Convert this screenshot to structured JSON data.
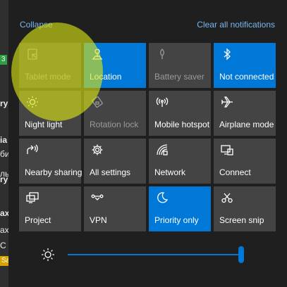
{
  "background_app": {
    "fragments": [
      "3",
      "ry",
      "ia",
      "би",
      "ль",
      "ry",
      "ax",
      "ах",
      "С",
      "Sa"
    ]
  },
  "header": {
    "collapse_label": "Collapse",
    "clear_label": "Clear all notifications"
  },
  "tiles": [
    {
      "label": "Tablet mode",
      "icon": "tablet-mode-icon",
      "state": "off"
    },
    {
      "label": "Location",
      "icon": "location-icon",
      "state": "on"
    },
    {
      "label": "Battery saver",
      "icon": "battery-saver-icon",
      "state": "off"
    },
    {
      "label": "Not connected",
      "icon": "bluetooth-icon",
      "state": "on"
    },
    {
      "label": "Night light",
      "icon": "night-light-icon",
      "state": "normal"
    },
    {
      "label": "Rotation lock",
      "icon": "rotation-lock-icon",
      "state": "off"
    },
    {
      "label": "Mobile hotspot",
      "icon": "mobile-hotspot-icon",
      "state": "normal"
    },
    {
      "label": "Airplane mode",
      "icon": "airplane-icon",
      "state": "normal"
    },
    {
      "label": "Nearby sharing",
      "icon": "nearby-sharing-icon",
      "state": "normal"
    },
    {
      "label": "All settings",
      "icon": "settings-gear-icon",
      "state": "normal"
    },
    {
      "label": "Network",
      "icon": "network-icon",
      "state": "normal"
    },
    {
      "label": "Connect",
      "icon": "connect-icon",
      "state": "normal"
    },
    {
      "label": "Project",
      "icon": "project-icon",
      "state": "normal"
    },
    {
      "label": "VPN",
      "icon": "vpn-icon",
      "state": "normal"
    },
    {
      "label": "Priority only",
      "icon": "moon-icon",
      "state": "on"
    },
    {
      "label": "Screen snip",
      "icon": "screen-snip-icon",
      "state": "normal"
    }
  ],
  "brightness": {
    "icon": "sun-icon",
    "level": 1.0
  },
  "colors": {
    "accent": "#0078d7",
    "tile_off": "#444444",
    "link": "#79b8f0",
    "highlight": "#dce614"
  }
}
